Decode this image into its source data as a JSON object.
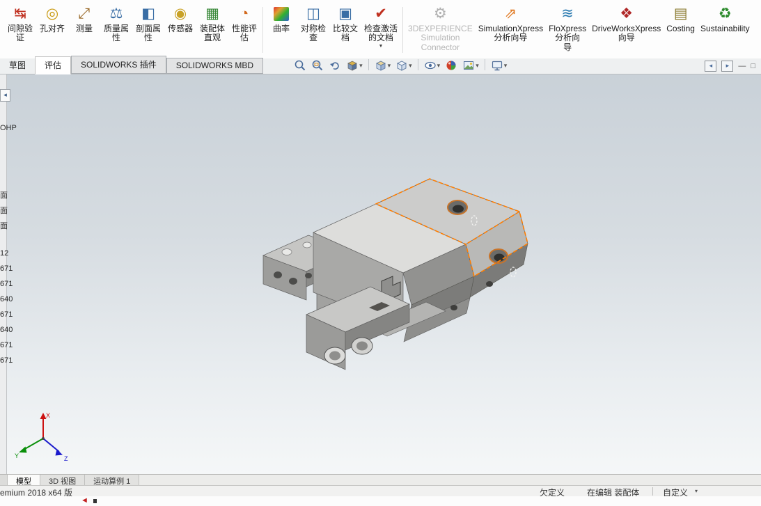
{
  "ribbon": {
    "tabs": [
      {
        "label": "草图"
      },
      {
        "label": "评估"
      },
      {
        "label": "SOLIDWORKS 插件"
      },
      {
        "label": "SOLIDWORKS MBD"
      }
    ],
    "active_tab": "评估",
    "buttons": [
      {
        "label": "间隙验\n证",
        "icon": "clearance-verification-icon",
        "glyph": "↹",
        "color": "#c03020",
        "enabled": true,
        "dropdown": false
      },
      {
        "label": "孔对齐",
        "icon": "hole-alignment-icon",
        "glyph": "◎",
        "color": "#c99a10",
        "enabled": true,
        "dropdown": false
      },
      {
        "label": "测量",
        "icon": "measure-icon",
        "glyph": "⤢",
        "color": "#9a6a2a",
        "enabled": true,
        "dropdown": false
      },
      {
        "label": "质量属\n性",
        "icon": "mass-properties-icon",
        "glyph": "⚖",
        "color": "#3a6ea5",
        "enabled": true,
        "dropdown": false
      },
      {
        "label": "剖面属\n性",
        "icon": "section-properties-icon",
        "glyph": "◧",
        "color": "#3a6ea5",
        "enabled": true,
        "dropdown": false
      },
      {
        "label": "传感器",
        "icon": "sensor-icon",
        "glyph": "◉",
        "color": "#c9a227",
        "enabled": true,
        "dropdown": false
      },
      {
        "label": "装配体\n直观",
        "icon": "assembly-visualization-icon",
        "glyph": "▦",
        "color": "#3a8a3a",
        "enabled": true,
        "dropdown": false
      },
      {
        "label": "性能评\n估",
        "icon": "performance-evaluation-icon",
        "glyph": "◔",
        "color": "#d2691e",
        "enabled": true,
        "dropdown": false
      },
      {
        "label": "曲率",
        "icon": "curvature-icon",
        "glyph": "",
        "color": "",
        "enabled": true,
        "dropdown": false
      },
      {
        "label": "对称检\n查",
        "icon": "symmetry-check-icon",
        "glyph": "◫",
        "color": "#3a6ea5",
        "enabled": true,
        "dropdown": false
      },
      {
        "label": "比较文\n档",
        "icon": "compare-documents-icon",
        "glyph": "▣",
        "color": "#3a6ea5",
        "enabled": true,
        "dropdown": false
      },
      {
        "label": "检查激活\n的文档",
        "icon": "check-active-document-icon",
        "glyph": "✔",
        "color": "#c03020",
        "enabled": true,
        "dropdown": true
      },
      {
        "label": "3DEXPERIENCE\nSimulation\nConnector",
        "icon": "threedexperience-connector-icon",
        "glyph": "⚙",
        "color": "#b0b0b0",
        "enabled": false,
        "dropdown": false
      },
      {
        "label": "SimulationXpress\n分析向导",
        "icon": "simulationxpress-icon",
        "glyph": "⇗",
        "color": "#e07820",
        "enabled": true,
        "dropdown": false
      },
      {
        "label": "FloXpress\n分析向\n导",
        "icon": "floxpress-icon",
        "glyph": "≋",
        "color": "#2a7ab0",
        "enabled": true,
        "dropdown": false
      },
      {
        "label": "DriveWorksXpress\n向导",
        "icon": "driveworksxpress-icon",
        "glyph": "❖",
        "color": "#b02828",
        "enabled": true,
        "dropdown": false
      },
      {
        "label": "Costing",
        "icon": "costing-icon",
        "glyph": "▤",
        "color": "#8a7a30",
        "enabled": true,
        "dropdown": false
      },
      {
        "label": "Sustainability",
        "icon": "sustainability-icon",
        "glyph": "♻",
        "color": "#2a8a2a",
        "enabled": true,
        "dropdown": false
      }
    ]
  },
  "viewport_toolbar": {
    "tools": [
      {
        "name": "zoom-to-fit",
        "dropdown": false
      },
      {
        "name": "zoom-to-area",
        "dropdown": false
      },
      {
        "name": "previous-view",
        "dropdown": false
      },
      {
        "name": "section-view",
        "dropdown": true
      },
      {
        "name": "view-orientation",
        "dropdown": true
      },
      {
        "name": "display-style",
        "dropdown": true
      },
      {
        "name": "hide-show-items",
        "dropdown": true
      },
      {
        "name": "edit-appearance",
        "dropdown": false
      },
      {
        "name": "apply-scene",
        "dropdown": true
      },
      {
        "name": "view-settings",
        "dropdown": true
      }
    ]
  },
  "pane_controls": {
    "prev": "◂",
    "next": "▸",
    "minimize": "—",
    "restore": "□"
  },
  "feature_panel": {
    "flyout_arrow": "◂",
    "text_fragments": [
      "OHP",
      "面",
      "面",
      "面"
    ],
    "number_fragments": [
      "12",
      "671",
      "671",
      "640",
      "671",
      "640",
      "671",
      "671"
    ]
  },
  "viewport": {
    "selection_color": "#ff7d00",
    "body_color": "#a9a9a7",
    "triad": {
      "x": "X",
      "y": "Y",
      "z": "Z"
    }
  },
  "bottom_tabs": {
    "tabs": [
      {
        "label": "模型"
      },
      {
        "label": "3D 视图"
      },
      {
        "label": "运动算例 1"
      }
    ],
    "active": "模型"
  },
  "status_bar": {
    "product": "emium 2018 x64 版",
    "definition_state": "欠定义",
    "edit_state": "在编辑 装配体",
    "toolbar_mode": "自定义"
  },
  "ui": {
    "caret_down": "▼",
    "caret_small": "▾",
    "red_marker": "◄"
  }
}
